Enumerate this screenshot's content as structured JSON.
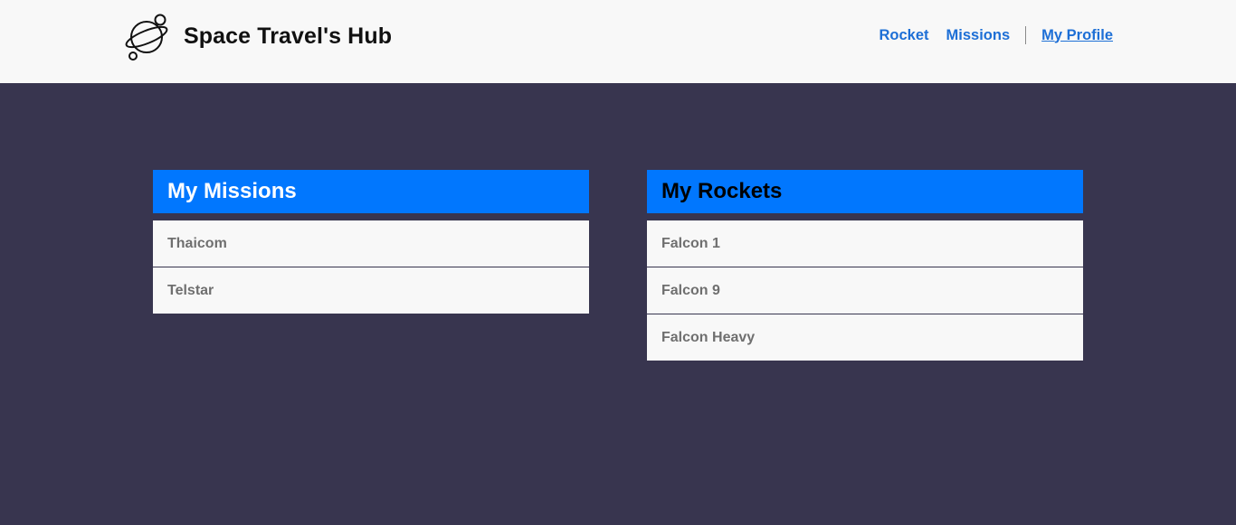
{
  "header": {
    "brand_title": "Space Travel's Hub",
    "logo_icon": "planet-icon",
    "nav": {
      "rocket": "Rocket",
      "missions": "Missions",
      "my_profile": "My Profile"
    }
  },
  "missions_panel": {
    "title": "My Missions",
    "items": [
      "Thaicom",
      "Telstar"
    ]
  },
  "rockets_panel": {
    "title": "My Rockets",
    "items": [
      "Falcon 1",
      "Falcon 9",
      "Falcon Heavy"
    ]
  },
  "colors": {
    "background": "#38354f",
    "header_bg": "#f8f8f8",
    "panel_header": "#0177fe",
    "link": "#1d6fd6",
    "list_bg": "#f8f8f8",
    "list_text": "#6f6f6f"
  }
}
